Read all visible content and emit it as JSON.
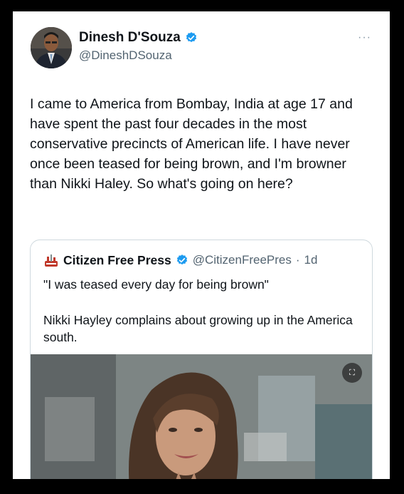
{
  "tweet": {
    "author_name": "Dinesh D'Souza",
    "author_handle": "@DineshDSouza",
    "more_label": "···",
    "text": "I came to America from Bombay, India at age 17 and have spent the past four decades in the most conservative precincts of American life. I have never once been teased for being brown, and I'm browner than Nikki Haley. So what's going on here?"
  },
  "quoted_tweet": {
    "author_name": "Citizen Free Press",
    "author_handle": "@CitizenFreePres",
    "separator": "·",
    "time": "1d",
    "line1": "\"I was teased every day for being brown\"",
    "line2": "Nikki Hayley complains about growing up in the America south."
  },
  "icons": {
    "verified": "verified-badge-icon",
    "more": "more-options-icon",
    "media_badge": "content-warning-icon"
  },
  "colors": {
    "verified_blue": "#1d9bf0",
    "text": "#0f1419",
    "secondary": "#536471"
  }
}
